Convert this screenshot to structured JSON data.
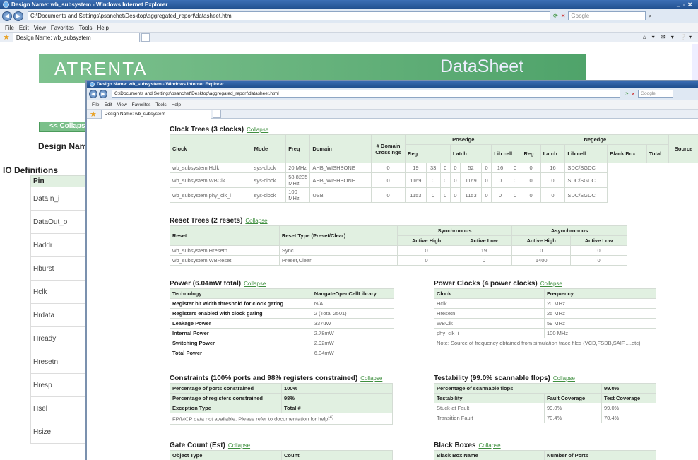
{
  "back_window": {
    "title": "Design Name: wb_subsystem - Windows Internet Explorer",
    "address": "C:\\Documents and Settings\\psanchet\\Desktop\\aggregated_report\\datasheet.html",
    "search_placeholder": "Google",
    "menu": [
      "File",
      "Edit",
      "View",
      "Favorites",
      "Tools",
      "Help"
    ],
    "tab": "Design Name: wb_subsystem",
    "banner_left": "ATRENTA",
    "banner_right": "DataSheet",
    "collapse_button": "<< Collaps",
    "design_name_label": "Design Nam",
    "io_heading": "IO Definitions",
    "io_col": "Pin",
    "pins": [
      "DataIn_i",
      "DataOut_o",
      "Haddr",
      "Hburst",
      "Hclk",
      "Hrdata",
      "Hready",
      "Hresetn",
      "Hresp",
      "Hsel",
      "Hsize"
    ]
  },
  "front_window": {
    "title": "Design Name: wb_subsystem - Windows Internet Explorer",
    "address": "C:\\Documents and Settings\\psanchet\\Desktop\\aggregated_report\\datasheet.html",
    "search_placeholder": "Google",
    "menu": [
      "File",
      "Edit",
      "View",
      "Favorites",
      "Tools",
      "Help"
    ],
    "tab": "Design Name: wb_subsystem"
  },
  "collapse": "Collapse",
  "clock": {
    "title": "Clock Trees (3 clocks)",
    "h": {
      "clock": "Clock",
      "mode": "Mode",
      "freq": "Freq",
      "domain": "Domain",
      "crossings": "# Domain Crossings",
      "posedge": "Posedge",
      "negedge": "Negedge",
      "reg": "Reg",
      "latch": "Latch",
      "libcell": "Lib cell",
      "blackbox": "Black Box",
      "total": "Total",
      "source": "Source"
    },
    "rows": [
      {
        "clock": "wb_subsystem.Hclk",
        "mode": "sys-clock",
        "freq": "20 MHz",
        "domain": "AHB_WISHBONE",
        "c": "0",
        "v": [
          "19",
          "33",
          "0",
          "0",
          "52",
          "0",
          "16",
          "0",
          "0",
          "16"
        ],
        "source": "SDC/SGDC"
      },
      {
        "clock": "wb_subsystem.WBClk",
        "mode": "sys-clock",
        "freq": "58.8235 MHz",
        "domain": "AHB_WISHBONE",
        "c": "0",
        "v": [
          "1169",
          "0",
          "0",
          "0",
          "1169",
          "0",
          "0",
          "0",
          "0",
          "0"
        ],
        "source": "SDC/SGDC"
      },
      {
        "clock": "wb_subsystem.phy_clk_i",
        "mode": "sys-clock",
        "freq": "100 MHz",
        "domain": "USB",
        "c": "0",
        "v": [
          "1153",
          "0",
          "0",
          "0",
          "1153",
          "0",
          "0",
          "0",
          "0",
          "0"
        ],
        "source": "SDC/SGDC"
      }
    ]
  },
  "reset": {
    "title": "Reset Trees (2 resets)",
    "h": {
      "reset": "Reset",
      "type": "Reset Type (Preset/Clear)",
      "sync": "Synchronous",
      "async": "Asynchronous",
      "ah": "Active High",
      "al": "Active Low"
    },
    "rows": [
      {
        "reset": "wb_subsystem.Hresetn",
        "type": "Sync",
        "v": [
          "0",
          "19",
          "0",
          "0"
        ]
      },
      {
        "reset": "wb_subsystem.WBReset",
        "type": "Preset,Clear",
        "v": [
          "0",
          "0",
          "1400",
          "0"
        ]
      }
    ]
  },
  "power": {
    "title": "Power (6.04mW total)",
    "h1": "Technology",
    "h2": "NangateOpenCellLibrary",
    "rows": [
      [
        "Register bit width threshold for clock gating",
        "N/A"
      ],
      [
        "Registers enabled with clock gating",
        "2 (Total 2501)"
      ],
      [
        "Leakage Power",
        "337uW"
      ],
      [
        "Internal Power",
        "2.78mW"
      ],
      [
        "Switching Power",
        "2.92mW"
      ],
      [
        "Total Power",
        "6.04mW"
      ]
    ]
  },
  "power_clocks": {
    "title": "Power Clocks (4 power clocks)",
    "h1": "Clock",
    "h2": "Frequency",
    "rows": [
      [
        "Hclk",
        "20 MHz"
      ],
      [
        "Hresetn",
        "25 MHz"
      ],
      [
        "WBClk",
        "59 MHz"
      ],
      [
        "phy_clk_i",
        "100 MHz"
      ]
    ],
    "note": "Note: Source of frequency obtained from simulation trace files (VCD,FSDB,SAIF.....etc)"
  },
  "constraints": {
    "title": "Constraints (100% ports and 98% registers constrained)",
    "rows": [
      [
        "Percentage of ports constrained",
        "100%"
      ],
      [
        "Percentage of registers constrained",
        "98%"
      ],
      [
        "Exception Type",
        "Total #"
      ]
    ],
    "note": "FP/MCP data not available. Please refer to documentation for help",
    "note_sup": "(4)"
  },
  "testability": {
    "title": "Testability (99.0% scannable flops)",
    "top": [
      "Percentage of scannable flops",
      "99.0%"
    ],
    "h": [
      "Testability",
      "Fault Coverage",
      "Test Coverage"
    ],
    "rows": [
      [
        "Stuck-at Fault",
        "99.0%",
        "99.0%"
      ],
      [
        "Transition Fault",
        "70.4%",
        "70.4%"
      ]
    ]
  },
  "gate": {
    "title": "Gate Count (Est)",
    "h": [
      "Object Type",
      "Count"
    ]
  },
  "blackbox": {
    "title": "Black Boxes",
    "h": [
      "Black Box Name",
      "Number of Ports"
    ]
  }
}
